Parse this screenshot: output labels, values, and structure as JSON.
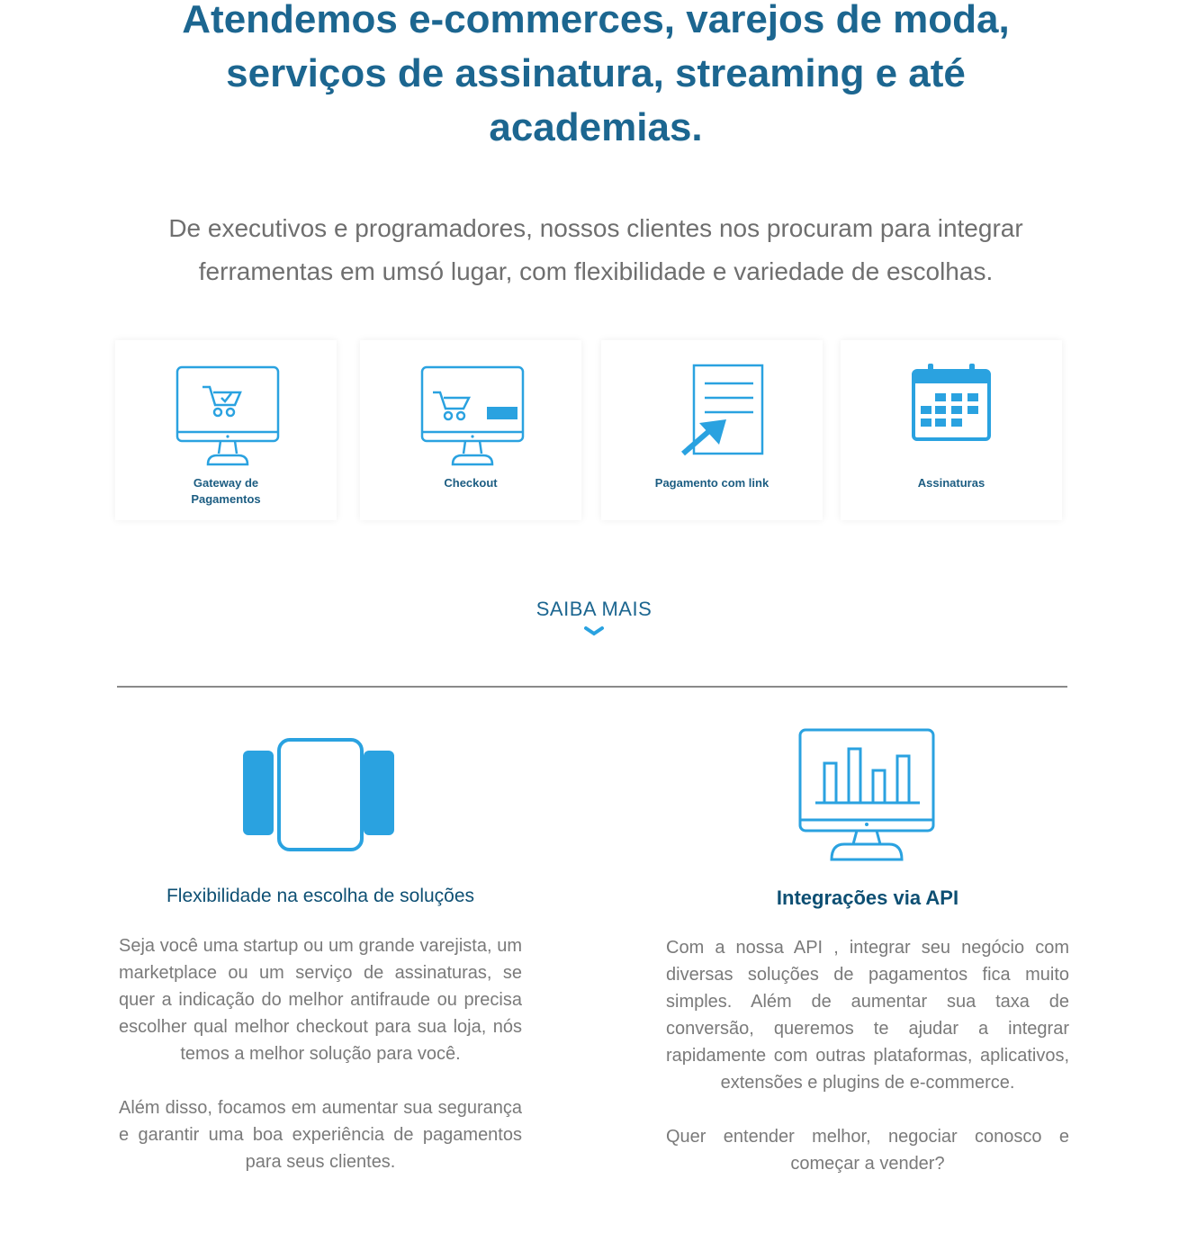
{
  "headline": "Atendemos e-commerces, varejos de moda, serviços de assinatura, streaming e até academias.",
  "intro": "De executivos e programadores, nossos clientes nos procuram para integrar ferramentas em umsó lugar, com flexibilidade e variedade de escolhas.",
  "cards": [
    {
      "label": "Gateway de Pagamentos",
      "icon": "monitor-cart-check-icon"
    },
    {
      "label": "Checkout",
      "icon": "monitor-cart-card-icon"
    },
    {
      "label": "Pagamento com link",
      "icon": "document-arrow-icon"
    },
    {
      "label": "Assinaturas",
      "icon": "calendar-icon"
    }
  ],
  "saiba_mais": {
    "label": "SAIBA MAIS",
    "icon": "chevron-down-icon"
  },
  "features": [
    {
      "title": "Flexibilidade na escolha de soluções",
      "icon": "panels-icon",
      "paragraphs": [
        "Seja você uma startup ou um grande varejista, um marketplace ou um serviço de assinaturas, se quer a indicação do melhor antifraude ou precisa escolher qual melhor checkout para sua loja, nós temos a melhor solução para você.",
        "Além disso, focamos em aumentar sua segurança e garantir uma boa experiência de pagamentos para seus clientes."
      ]
    },
    {
      "title": "Integrações via API",
      "icon": "monitor-bar-chart-icon",
      "paragraphs": [
        "Com a nossa API , integrar seu negócio com diversas soluções de pagamentos fica muito simples. Além de aumentar sua taxa de conversão, queremos te ajudar a integrar rapidamente com outras plataformas, aplicativos, extensões e plugins de e-commerce.",
        "Quer entender melhor, negociar conosco e começar a vender?"
      ]
    }
  ],
  "colors": {
    "heading": "#1c6690",
    "accent": "#2aa2e0",
    "text": "#7a7a7a",
    "dark_blue": "#0d4f73"
  }
}
